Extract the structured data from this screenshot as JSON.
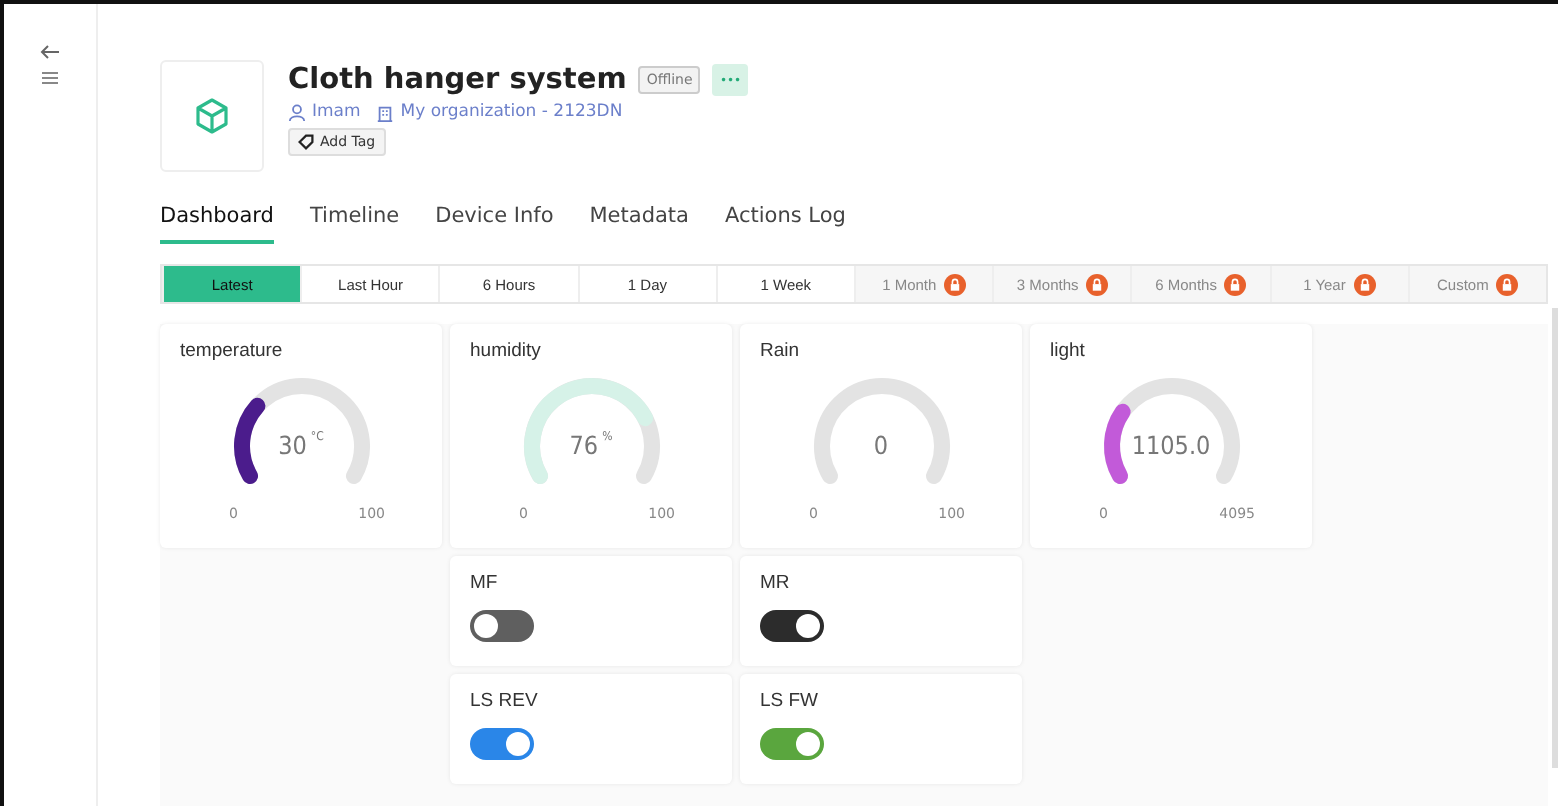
{
  "device": {
    "title": "Cloth hanger system",
    "status": "Offline",
    "more_button": "•••",
    "owner": "Imam",
    "organization": "My organization - 2123DN",
    "add_tag": "Add Tag"
  },
  "tabs": [
    {
      "label": "Dashboard",
      "selected": true
    },
    {
      "label": "Timeline",
      "selected": false
    },
    {
      "label": "Device Info",
      "selected": false
    },
    {
      "label": "Metadata",
      "selected": false
    },
    {
      "label": "Actions Log",
      "selected": false
    }
  ],
  "time_ranges": [
    {
      "label": "Latest",
      "selected": true,
      "locked": false
    },
    {
      "label": "Last Hour",
      "selected": false,
      "locked": false
    },
    {
      "label": "6 Hours",
      "selected": false,
      "locked": false
    },
    {
      "label": "1 Day",
      "selected": false,
      "locked": false
    },
    {
      "label": "1 Week",
      "selected": false,
      "locked": false
    },
    {
      "label": "1 Month",
      "selected": false,
      "locked": true
    },
    {
      "label": "3 Months",
      "selected": false,
      "locked": true
    },
    {
      "label": "6 Months",
      "selected": false,
      "locked": true
    },
    {
      "label": "1 Year",
      "selected": false,
      "locked": true
    },
    {
      "label": "Custom",
      "selected": false,
      "locked": true
    }
  ],
  "gauges": [
    {
      "title": "temperature",
      "value": "30",
      "unit": "°C",
      "min": "0",
      "max": "100"
    },
    {
      "title": "humidity",
      "value": "76",
      "unit": "%",
      "min": "0",
      "max": "100"
    },
    {
      "title": "Rain",
      "value": "0",
      "min": "0",
      "max": "100"
    },
    {
      "title": "light",
      "value": "1105.0",
      "min": "0",
      "max": "4095"
    }
  ],
  "switches": [
    {
      "title": "MF",
      "on": false,
      "color": "#5f5f5f"
    },
    {
      "title": "MR",
      "on": true,
      "color": "#2c2c2c"
    },
    {
      "title": "LS REV",
      "on": true,
      "color": "#2a86e8"
    },
    {
      "title": "LS FW",
      "on": true,
      "color": "#5aa63e"
    }
  ]
}
